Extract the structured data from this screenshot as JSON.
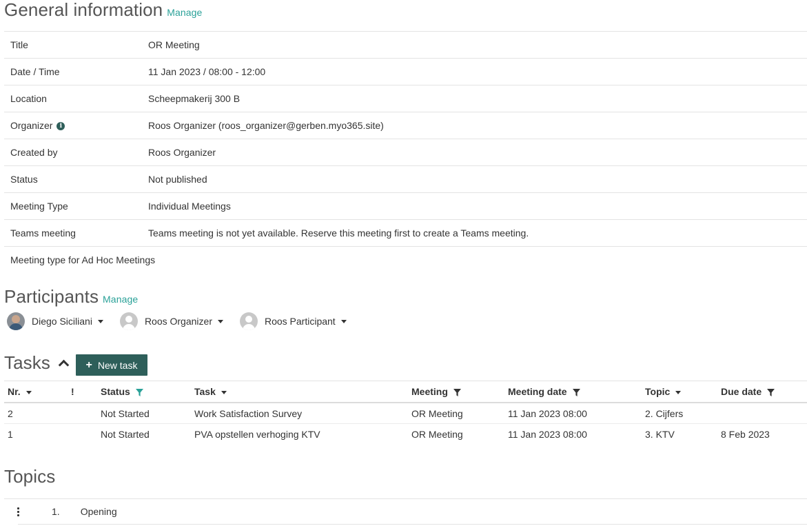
{
  "general": {
    "heading": "General information",
    "manage": "Manage",
    "rows": [
      {
        "label": "Title",
        "value": "OR Meeting"
      },
      {
        "label": "Date / Time",
        "value": "11 Jan 2023 / 08:00 - 12:00"
      },
      {
        "label": "Location",
        "value": "Scheepmakerij 300 B"
      },
      {
        "label": "Organizer",
        "value": "Roos Organizer (roos_organizer@gerben.myo365.site)"
      },
      {
        "label": "Created by",
        "value": "Roos Organizer"
      },
      {
        "label": "Status",
        "value": "Not published"
      },
      {
        "label": "Meeting Type",
        "value": "Individual Meetings"
      },
      {
        "label": "Teams meeting",
        "value": "Teams meeting is not yet available. Reserve this meeting first to create a Teams meeting."
      },
      {
        "label": "Meeting type for Ad Hoc Meetings",
        "value": ""
      }
    ]
  },
  "participants": {
    "heading": "Participants",
    "manage": "Manage",
    "people": [
      {
        "name": "Diego Siciliani"
      },
      {
        "name": "Roos Organizer"
      },
      {
        "name": "Roos Participant"
      }
    ]
  },
  "tasks": {
    "heading": "Tasks",
    "new_task": "New task",
    "columns": {
      "nr": "Nr.",
      "priority": "!",
      "status": "Status",
      "task": "Task",
      "meeting": "Meeting",
      "meeting_date": "Meeting date",
      "topic": "Topic",
      "due_date": "Due date"
    },
    "rows": [
      {
        "nr": "2",
        "status": "Not Started",
        "task": "Work Satisfaction Survey",
        "meeting": "OR Meeting",
        "meeting_date": "11 Jan 2023 08:00",
        "topic": "2. Cijfers",
        "due_date": ""
      },
      {
        "nr": "1",
        "status": "Not Started",
        "task": "PVA opstellen verhoging KTV",
        "meeting": "OR Meeting",
        "meeting_date": "11 Jan 2023 08:00",
        "topic": "3. KTV",
        "due_date": "8 Feb 2023"
      }
    ]
  },
  "topics": {
    "heading": "Topics",
    "items": [
      {
        "nr": "1.",
        "title": "Opening"
      }
    ]
  },
  "colors": {
    "accent": "#2aa198",
    "button": "#2e5f5a",
    "filter_active": "#2aa198"
  }
}
